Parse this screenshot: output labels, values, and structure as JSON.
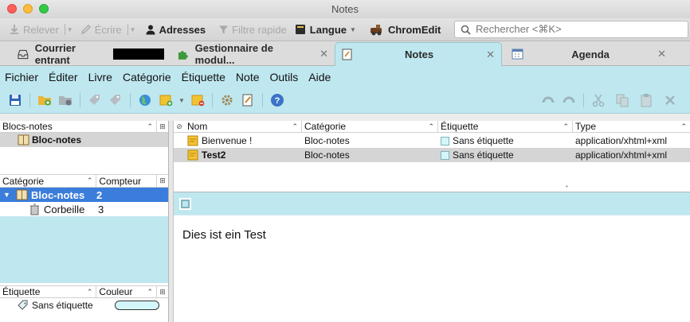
{
  "window": {
    "title": "Notes"
  },
  "toolbar": {
    "relever": "Relever",
    "ecrire": "Écrire",
    "adresses": "Adresses",
    "filtre": "Filtre rapide",
    "langue": "Langue",
    "chromedit": "ChromEdit",
    "search_placeholder": "Rechercher <⌘K>"
  },
  "tabs": [
    {
      "label": "Courrier entrant"
    },
    {
      "label": "Gestionnaire de modul..."
    },
    {
      "label": "Notes"
    },
    {
      "label": "Agenda"
    }
  ],
  "menu": [
    "Fichier",
    "Éditer",
    "Livre",
    "Catégorie",
    "Étiquette",
    "Note",
    "Outils",
    "Aide"
  ],
  "notebooks": {
    "header": "Blocs-notes",
    "items": [
      {
        "label": "Bloc-notes"
      }
    ]
  },
  "categories": {
    "header_name": "Catégorie",
    "header_count": "Compteur",
    "rows": [
      {
        "name": "Bloc-notes",
        "count": "2"
      },
      {
        "name": "Corbeille",
        "count": "3"
      }
    ]
  },
  "labels": {
    "header_name": "Étiquette",
    "header_color": "Couleur",
    "rows": [
      {
        "name": "Sans étiquette",
        "color": "#d3f6fb"
      }
    ]
  },
  "notes_table": {
    "headers": {
      "name": "Nom",
      "category": "Catégorie",
      "label": "Étiquette",
      "type": "Type"
    },
    "rows": [
      {
        "name": "Bienvenue !",
        "category": "Bloc-notes",
        "label": "Sans étiquette",
        "type": "application/xhtml+xml"
      },
      {
        "name": "Test2",
        "category": "Bloc-notes",
        "label": "Sans étiquette",
        "type": "application/xhtml+xml"
      }
    ]
  },
  "note_content": "Dies ist ein Test",
  "colors": {
    "accent": "#bfe7ef",
    "selection": "#3a7ddb"
  }
}
